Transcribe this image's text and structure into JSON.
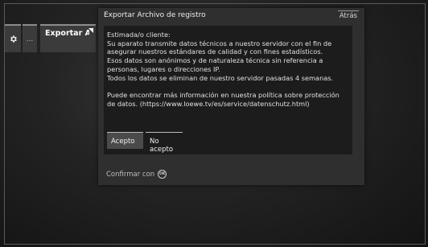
{
  "menu_tiles": {
    "dots": "...",
    "export_label": "Exportar Archivo de"
  },
  "dialog": {
    "title": "Exportar Archivo de registro",
    "back_label": "Atrás",
    "message": "Estimada/o cliente:\nSu aparato transmite datos técnicos a nuestro servidor con el fin de\nasegurar nuestros estándares de calidad y con fines estadísticos.\nEsos datos son anónimos y de naturaleza técnica sin referencia a\npersonas, lugares o direcciones IP.\nTodos los datos se eliminan de nuestro servidor pasadas 4 semanas.\n\nPuede encontrar más información en nuestra política sobre protección\nde datos. (https://www.loewe.tv/es/service/datenschutz.html)",
    "accept_label": "Acepto",
    "decline_label": "No acepto",
    "footer_label": "Confirmar con",
    "footer_icon": "ok-button-icon",
    "footer_icon_text": "OK"
  },
  "colors": {
    "dialog_bg": "#2f2f2f",
    "body_bg": "#1c1c1c",
    "selected_button": "#4a4a4a"
  }
}
